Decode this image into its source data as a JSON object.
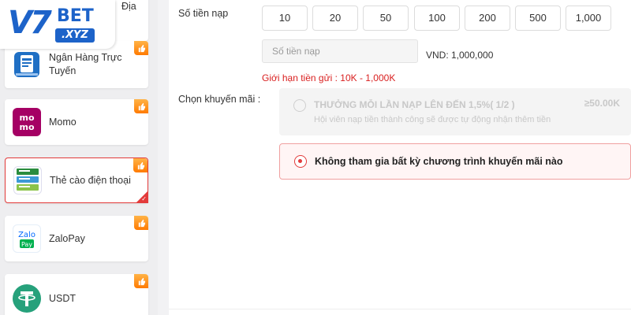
{
  "logo": {
    "v7": "V7",
    "bet": "BET",
    "xyz": ".XYZ"
  },
  "sidebar": {
    "items": [
      {
        "label": "Địa",
        "icon": "bank-icon"
      },
      {
        "label": "Ngân Hàng Trực Tuyến",
        "icon": "online-bank-icon"
      },
      {
        "label": "Momo",
        "icon": "momo-icon"
      },
      {
        "label": "Thẻ cào điện thoại",
        "icon": "phone-card-icon",
        "active": true
      },
      {
        "label": "ZaloPay",
        "icon": "zalopay-icon"
      },
      {
        "label": "USDT",
        "icon": "usdt-icon"
      }
    ]
  },
  "deposit": {
    "amount_label": "Số tiền nạp",
    "amounts": [
      "10",
      "20",
      "50",
      "100",
      "200",
      "500",
      "1,000"
    ],
    "input_placeholder": "Số tiền nạp",
    "vnd_text": "VND: 1,000,000",
    "limit_text": "Giới hạn tiền gửi :  10K - 1,000K"
  },
  "promotion": {
    "label": "Chọn khuyến mãi :",
    "options": [
      {
        "title": "THƯỞNG MỖI LẦN NẠP LÊN ĐẾN 1,5%( 1/2 )",
        "subtitle": "Hội viên nạp tiền thành công sẽ được tự động nhận thêm tiền",
        "amount": "≥50.00K",
        "selected": false
      },
      {
        "title": "Không tham gia bất kỳ chương trình khuyến mãi nào",
        "selected": true
      }
    ]
  },
  "colors": {
    "accent": "#e33b3b",
    "brand": "#1d63c9",
    "limit_text": "#d92020"
  }
}
